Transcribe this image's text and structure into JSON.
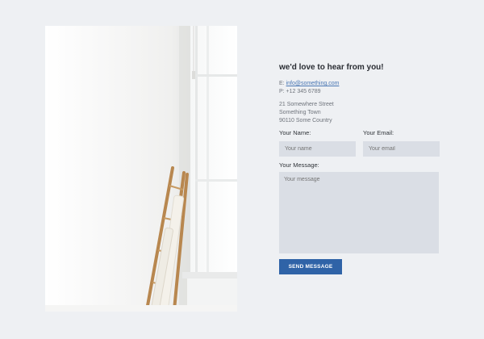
{
  "contact": {
    "heading": "we'd love to hear from you!",
    "email_prefix": "E: ",
    "email": "info@something.com",
    "phone": "P: +12 345 6789",
    "address_line1": "21 Somewhere Street",
    "address_line2": "Something Town",
    "address_line3": "90110 Some Country"
  },
  "form": {
    "name_label": "Your Name:",
    "name_placeholder": "Your name",
    "email_label": "Your Email:",
    "email_placeholder": "Your email",
    "message_label": "Your Message:",
    "message_placeholder": "Your message",
    "submit_label": "SEND MESSAGE"
  },
  "colors": {
    "background": "#eef0f3",
    "field_background": "#dadee5",
    "button": "#2f63a7"
  }
}
